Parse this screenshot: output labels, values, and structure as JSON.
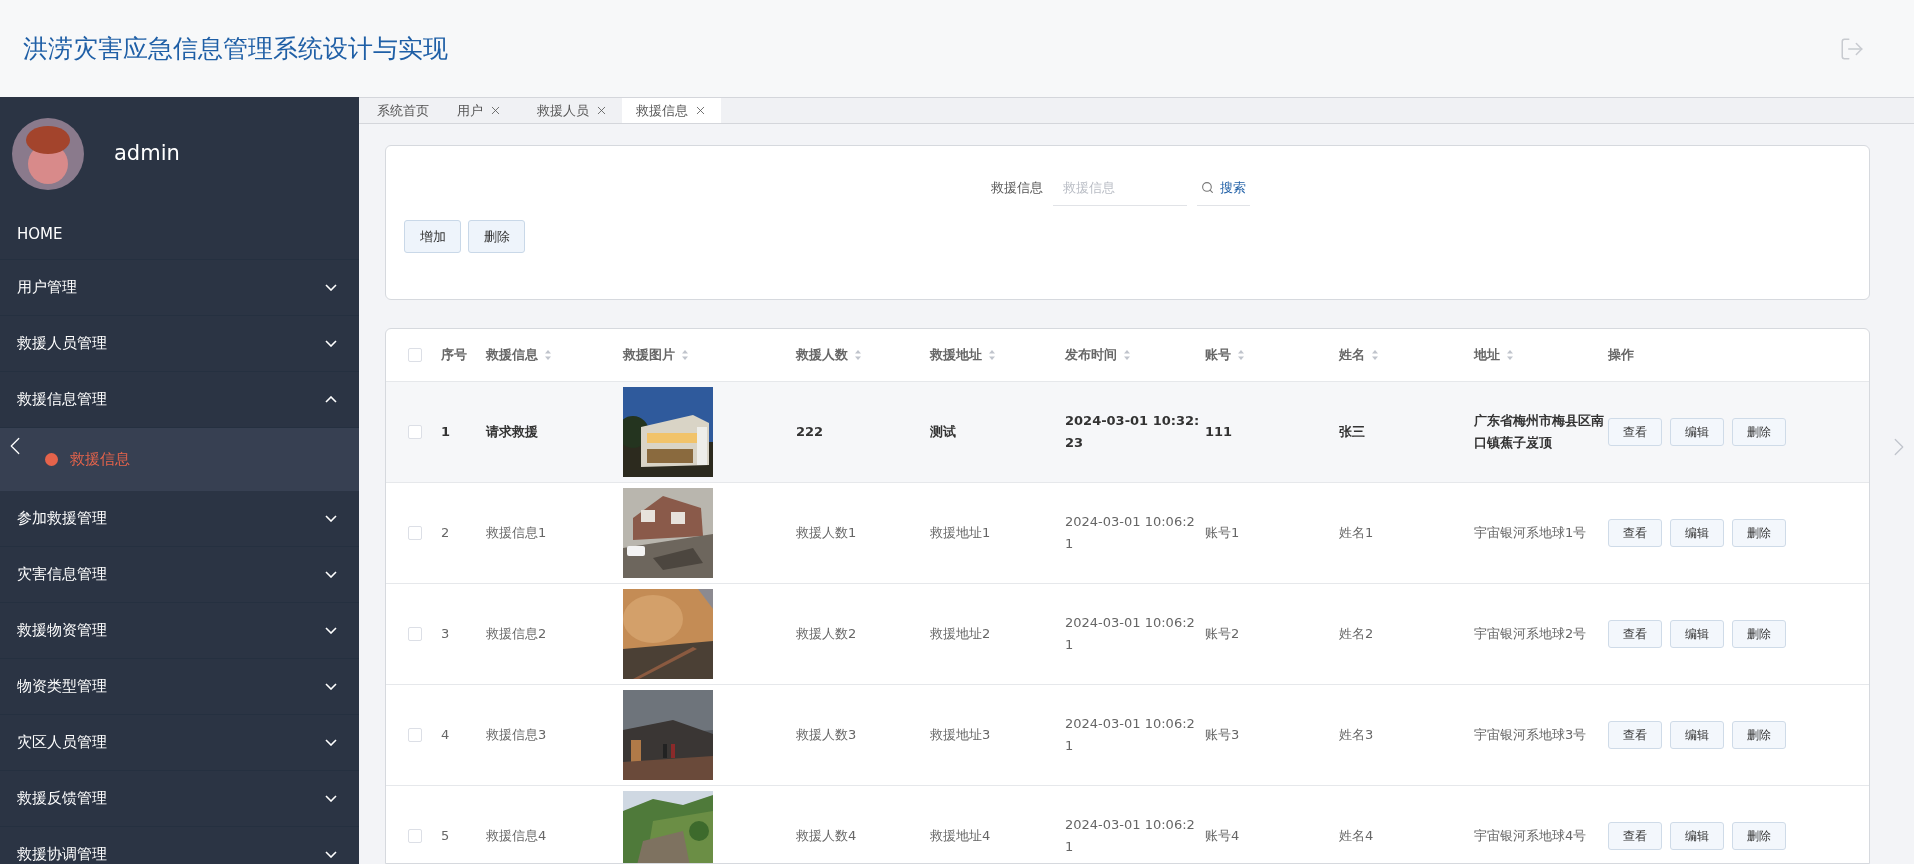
{
  "header": {
    "title": "洪涝灾害应急信息管理系统设计与实现"
  },
  "sidebar": {
    "user": "admin",
    "home": "HOME",
    "menus": [
      {
        "label": "用户管理",
        "expanded": false
      },
      {
        "label": "救援人员管理",
        "expanded": false
      },
      {
        "label": "救援信息管理",
        "expanded": true,
        "children": [
          {
            "label": "救援信息",
            "selected": true
          }
        ]
      },
      {
        "label": "参加救援管理",
        "expanded": false
      },
      {
        "label": "灾害信息管理",
        "expanded": false
      },
      {
        "label": "救援物资管理",
        "expanded": false
      },
      {
        "label": "物资类型管理",
        "expanded": false
      },
      {
        "label": "灾区人员管理",
        "expanded": false
      },
      {
        "label": "救援反馈管理",
        "expanded": false
      },
      {
        "label": "救援协调管理",
        "expanded": false
      }
    ]
  },
  "tabs": [
    {
      "label": "系统首页",
      "closable": false,
      "selected": false
    },
    {
      "label": "用户",
      "closable": true,
      "selected": false
    },
    {
      "label": "救援人员",
      "closable": true,
      "selected": false
    },
    {
      "label": "救援信息",
      "closable": true,
      "selected": true
    }
  ],
  "search": {
    "label": "救援信息",
    "placeholder": "救援信息",
    "button": "搜索"
  },
  "actions": [
    "增加",
    "删除"
  ],
  "table": {
    "all_checked": false,
    "columns": [
      {
        "label": "序号",
        "kind": "text",
        "sortable": false
      },
      {
        "label": "救援信息",
        "kind": "text",
        "sortable": true
      },
      {
        "label": "救援图片",
        "kind": "picture",
        "sortable": true
      },
      {
        "label": "救援人数",
        "kind": "text",
        "sortable": true
      },
      {
        "label": "救援地址",
        "kind": "text",
        "sortable": true
      },
      {
        "label": "发布时间",
        "kind": "text",
        "sortable": true
      },
      {
        "label": "账号",
        "kind": "text",
        "sortable": true
      },
      {
        "label": "姓名",
        "kind": "text",
        "sortable": true
      },
      {
        "label": "地址",
        "kind": "text",
        "sortable": true
      },
      {
        "label": "操作",
        "kind": "actions",
        "sortable": false
      }
    ],
    "rows": [
      {
        "checked": false,
        "hovered": true,
        "cells": [
          "1",
          "请求救援",
          {
            "kind": "picture"
          },
          "222",
          "测试",
          "2024-03-01 10:32:23",
          "111",
          "张三",
          "广东省梅州市梅县区南口镇蕉子岌顶"
        ],
        "actions": [
          "查看",
          "编辑",
          "删除"
        ]
      },
      {
        "checked": false,
        "hovered": false,
        "cells": [
          "2",
          "救援信息1",
          {
            "kind": "picture"
          },
          "救援人数1",
          "救援地址1",
          "2024-03-01 10:06:21",
          "账号1",
          "姓名1",
          "宇宙银河系地球1号"
        ],
        "actions": [
          "查看",
          "编辑",
          "删除"
        ]
      },
      {
        "checked": false,
        "hovered": false,
        "cells": [
          "3",
          "救援信息2",
          {
            "kind": "picture"
          },
          "救援人数2",
          "救援地址2",
          "2024-03-01 10:06:21",
          "账号2",
          "姓名2",
          "宇宙银河系地球2号"
        ],
        "actions": [
          "查看",
          "编辑",
          "删除"
        ]
      },
      {
        "checked": false,
        "hovered": false,
        "cells": [
          "4",
          "救援信息3",
          {
            "kind": "picture"
          },
          "救援人数3",
          "救援地址3",
          "2024-03-01 10:06:21",
          "账号3",
          "姓名3",
          "宇宙银河系地球3号"
        ],
        "actions": [
          "查看",
          "编辑",
          "删除"
        ]
      },
      {
        "checked": false,
        "hovered": false,
        "cells": [
          "5",
          "救援信息4",
          {
            "kind": "picture"
          },
          "救援人数4",
          "救援地址4",
          "2024-03-01 10:06:21",
          "账号4",
          "姓名4",
          "宇宙银河系地球4号"
        ],
        "actions": [
          "查看",
          "编辑",
          "删除"
        ]
      }
    ]
  }
}
